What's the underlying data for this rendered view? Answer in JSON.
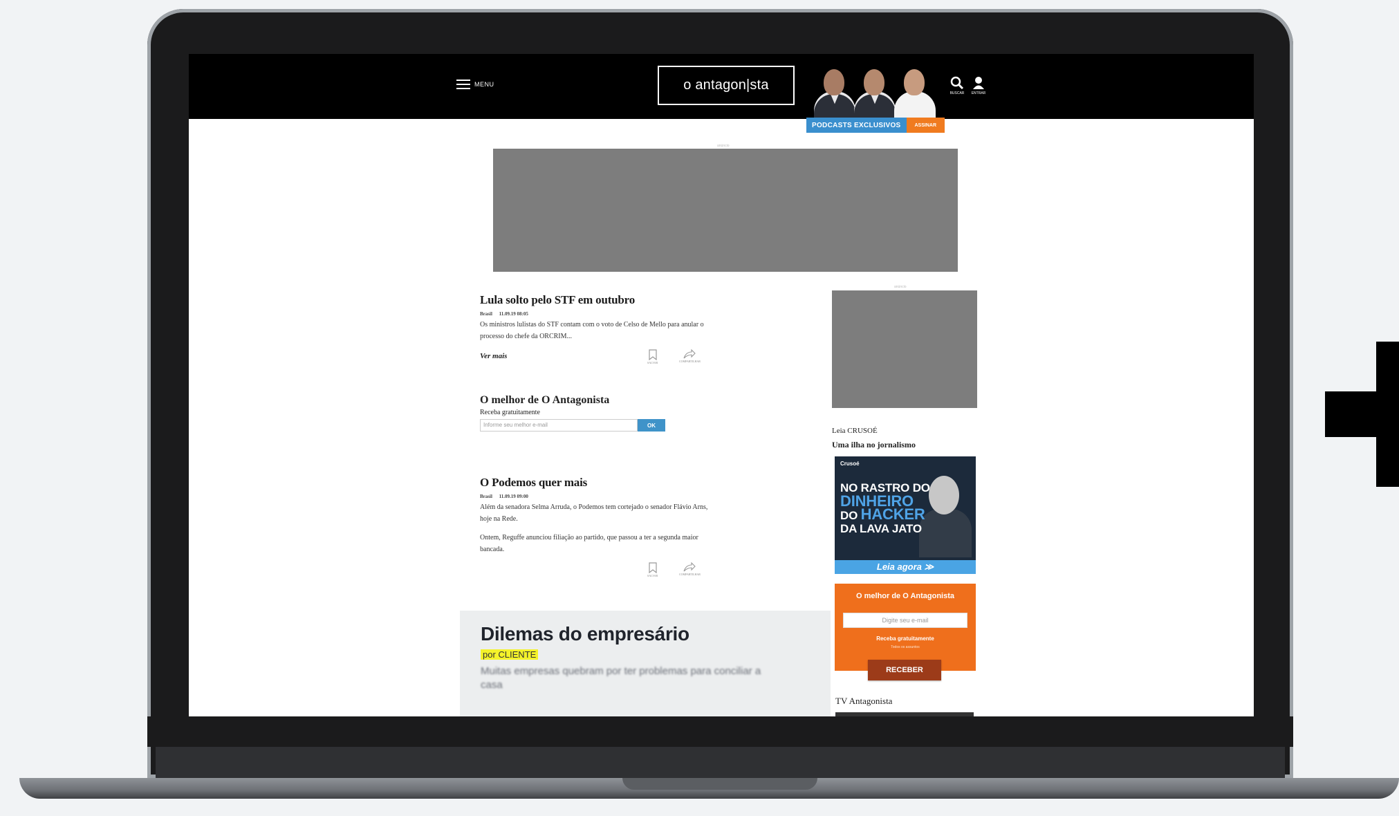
{
  "header": {
    "menu_label": "MENU",
    "logo_text": "o antagon|sta",
    "podcast_badge": "PODCASTS EXCLUSIVOS",
    "podcast_cta": "ASSINAR",
    "search_label": "BUSCAR",
    "account_label": "ENTRAR"
  },
  "ads": {
    "top_tag": "anúncio",
    "side_tag": "anúncio"
  },
  "articles": [
    {
      "title": "Lula solto pelo STF em outubro",
      "section": "Brasil",
      "date": "11.09.19 08:05",
      "body": [
        "Os ministros lulistas do STF contam com o voto de Celso de Mello para anular o processo do chefe da ORCRIM..."
      ],
      "more": "Ver mais",
      "save_label": "SALVAR",
      "share_label": "COMPARTILHAR"
    },
    {
      "title": "O Podemos quer mais",
      "section": "Brasil",
      "date": "11.09.19 09:00",
      "body": [
        "Além da senadora Selma Arruda, o Podemos tem cortejado o senador Flávio Arns, hoje na Rede.",
        "Ontem, Reguffe anunciou filiação ao partido, que passou a ter a segunda maior bancada."
      ],
      "save_label": "SALVAR",
      "share_label": "COMPARTILHAR"
    }
  ],
  "newsletter": {
    "title": "O melhor de O Antagonista",
    "subtitle": "Receba gratuitamente",
    "placeholder": "Informe seu melhor e-mail",
    "button": "OK"
  },
  "promo": {
    "title": "Dilemas do empresário",
    "author": "por CLIENTE",
    "text": "Muitas empresas quebram por ter problemas para conciliar a casa"
  },
  "sidebar": {
    "crusoe_prefix": "Leia CRUSOÉ",
    "crusoe_tagline": "Uma ilha no jornalismo",
    "crusoe_ad": {
      "brand": "Crusoé",
      "line1": "NO RASTRO DO",
      "line2": "DINHEIRO",
      "line3a": "DO ",
      "line3b": "HACKER",
      "line4": "DA LAVA JATO",
      "cta": "Leia agora ≫"
    },
    "orange_box": {
      "title": "O melhor de O Antagonista",
      "placeholder": "Digite seu e-mail",
      "subtitle": "Receba gratuitamente",
      "tiny": "Todos os assuntos",
      "button": "RECEBER"
    },
    "tv_title": "TV Antagonista"
  },
  "colors": {
    "header_bg": "#000000",
    "podcast_blue": "#3a8fce",
    "podcast_orange": "#f07b1f",
    "newsletter_blue": "#3f93c9",
    "orange_box": "#ef6f1c",
    "orange_button": "#9c3b19",
    "promo_highlight": "#f4f22a"
  }
}
